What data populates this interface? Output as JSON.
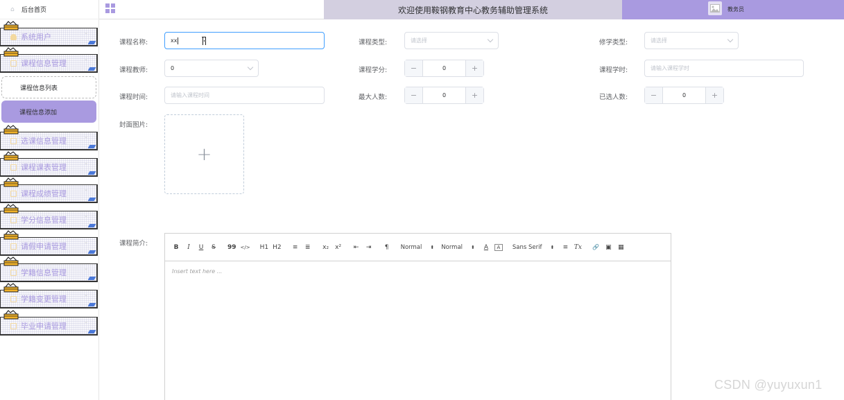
{
  "header": {
    "title": "欢迎使用鞍钢教育中心教务辅助管理系统",
    "user_name": "教务员"
  },
  "sidebar": {
    "home": "后台首页",
    "items": [
      {
        "label": "系统用户"
      },
      {
        "label": "课程信息管理"
      },
      {
        "label": "选课信息管理"
      },
      {
        "label": "课程课表管理"
      },
      {
        "label": "课程成绩管理"
      },
      {
        "label": "学分信息管理"
      },
      {
        "label": "请假申请管理"
      },
      {
        "label": "学籍信息管理"
      },
      {
        "label": "学籍变更管理"
      },
      {
        "label": "毕业申请管理"
      }
    ],
    "sub_items": [
      {
        "label": "课程信息列表"
      },
      {
        "label": "课程信息添加"
      }
    ]
  },
  "form": {
    "course_name": {
      "label": "课程名称:",
      "value": "xx"
    },
    "course_type": {
      "label": "课程类型:",
      "placeholder": "请选择"
    },
    "study_type": {
      "label": "修学类型:",
      "placeholder": "请选择"
    },
    "teacher": {
      "label": "课程教师:",
      "value": "0"
    },
    "credit": {
      "label": "课程学分:",
      "value": "0"
    },
    "hours": {
      "label": "课程学时:",
      "placeholder": "请输入课程学时"
    },
    "time": {
      "label": "课程时间:",
      "placeholder": "请输入课程时间"
    },
    "max_people": {
      "label": "最大人数:",
      "value": "0"
    },
    "selected_people": {
      "label": "已选人数:",
      "value": "0"
    },
    "cover": {
      "label": "封面图片:"
    },
    "intro": {
      "label": "课程简介:"
    }
  },
  "editor": {
    "placeholder": "Insert text here ...",
    "header_picker": "Normal",
    "size_picker": "Normal",
    "font_picker": "Sans Serif",
    "buttons": [
      "B",
      "I",
      "U",
      "S",
      "99",
      "</>",
      "H1",
      "H2",
      "≡",
      "≣",
      "x₂",
      "x²",
      "⇤",
      "⇥",
      "¶",
      "A",
      "A",
      "≡",
      "Tx",
      "🔗",
      "▣",
      "▦"
    ]
  },
  "watermark": "CSDN @yuyuxun1",
  "colors": {
    "accent": "#a99ae0",
    "title_band": "#d3cfe0",
    "focus": "#409eff"
  }
}
